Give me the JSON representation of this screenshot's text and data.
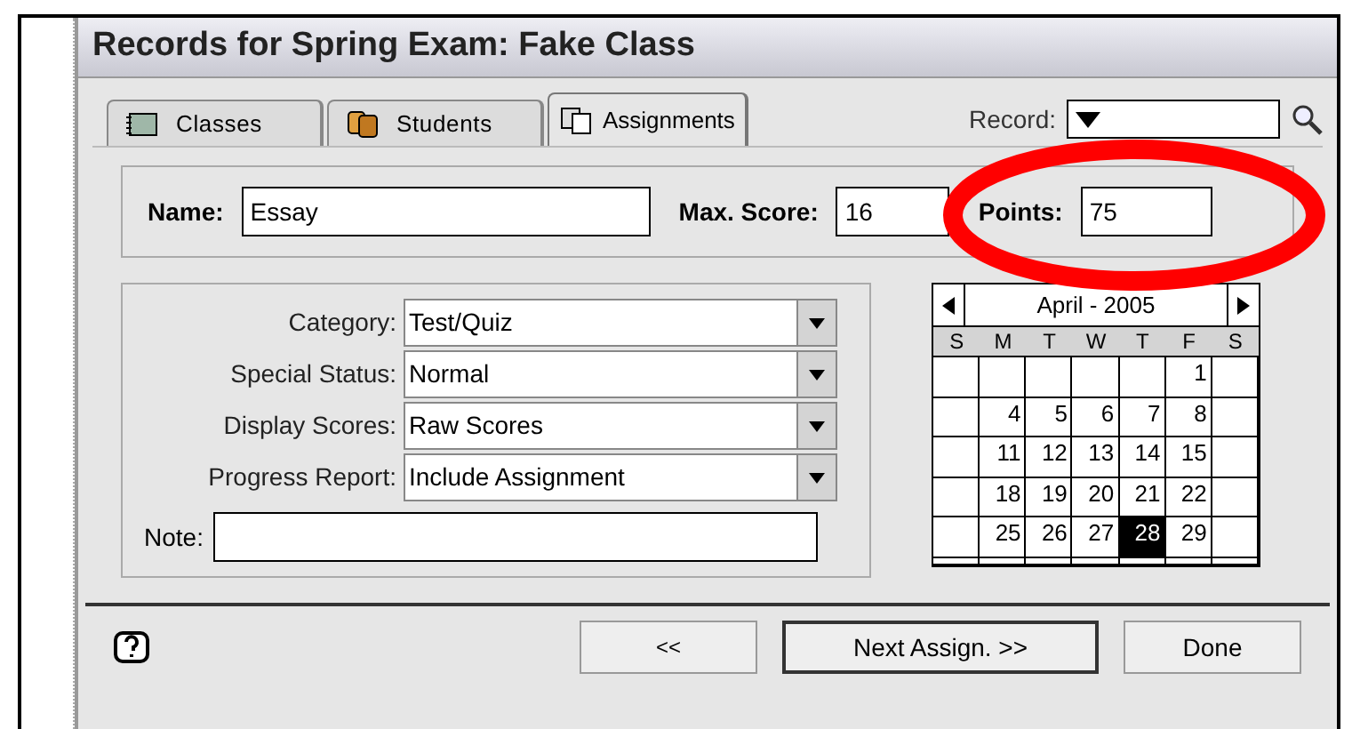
{
  "window": {
    "title": "Records for Spring Exam: Fake Class"
  },
  "tabs": [
    {
      "label": "Classes",
      "selected": false
    },
    {
      "label": "Students",
      "selected": false
    },
    {
      "label": "Assignments",
      "selected": true
    }
  ],
  "record": {
    "label": "Record:"
  },
  "name_row": {
    "name_label": "Name:",
    "name_value": "Essay",
    "max_label": "Max. Score:",
    "max_value": "16",
    "points_label": "Points:",
    "points_value": "75"
  },
  "fields": [
    {
      "label": "Category:",
      "value": "Test/Quiz"
    },
    {
      "label": "Special Status:",
      "value": "Normal"
    },
    {
      "label": "Display Scores:",
      "value": "Raw Scores"
    },
    {
      "label": "Progress Report:",
      "value": "Include Assignment"
    }
  ],
  "note": {
    "label": "Note:"
  },
  "calendar": {
    "month": "April - 2005",
    "weekdays": [
      "S",
      "M",
      "T",
      "W",
      "T",
      "F",
      "S"
    ],
    "weeks": [
      [
        {
          "kind": "blank"
        },
        {
          "kind": "blank"
        },
        {
          "kind": "blank"
        },
        {
          "kind": "blank"
        },
        {
          "kind": "blank"
        },
        {
          "kind": "day",
          "day": "1",
          "selected": false
        },
        {
          "kind": "blank"
        }
      ],
      [
        {
          "kind": "blank"
        },
        {
          "kind": "day",
          "day": "4",
          "selected": false
        },
        {
          "kind": "day",
          "day": "5",
          "selected": false
        },
        {
          "kind": "day",
          "day": "6",
          "selected": false
        },
        {
          "kind": "day",
          "day": "7",
          "selected": false
        },
        {
          "kind": "day",
          "day": "8",
          "selected": false
        },
        {
          "kind": "blank"
        }
      ],
      [
        {
          "kind": "blank"
        },
        {
          "kind": "day",
          "day": "11",
          "selected": false
        },
        {
          "kind": "day",
          "day": "12",
          "selected": false
        },
        {
          "kind": "day",
          "day": "13",
          "selected": false
        },
        {
          "kind": "day",
          "day": "14",
          "selected": false
        },
        {
          "kind": "day",
          "day": "15",
          "selected": false
        },
        {
          "kind": "blank"
        }
      ],
      [
        {
          "kind": "blank"
        },
        {
          "kind": "day",
          "day": "18",
          "selected": false
        },
        {
          "kind": "day",
          "day": "19",
          "selected": false
        },
        {
          "kind": "day",
          "day": "20",
          "selected": false
        },
        {
          "kind": "day",
          "day": "21",
          "selected": false
        },
        {
          "kind": "day",
          "day": "22",
          "selected": false
        },
        {
          "kind": "blank"
        }
      ],
      [
        {
          "kind": "blank"
        },
        {
          "kind": "day",
          "day": "25",
          "selected": false
        },
        {
          "kind": "day",
          "day": "26",
          "selected": false
        },
        {
          "kind": "day",
          "day": "27",
          "selected": false
        },
        {
          "kind": "day",
          "day": "28",
          "selected": true
        },
        {
          "kind": "day",
          "day": "29",
          "selected": false
        },
        {
          "kind": "blank"
        }
      ],
      [
        {
          "kind": "blank"
        },
        {
          "kind": "blank"
        },
        {
          "kind": "blank"
        },
        {
          "kind": "blank"
        },
        {
          "kind": "blank"
        },
        {
          "kind": "blank"
        },
        {
          "kind": "blank"
        }
      ]
    ]
  },
  "buttons": [
    {
      "label": "<<",
      "default": false
    },
    {
      "label": "Next Assign. >>",
      "default": true
    },
    {
      "label": "Done",
      "default": false
    }
  ]
}
